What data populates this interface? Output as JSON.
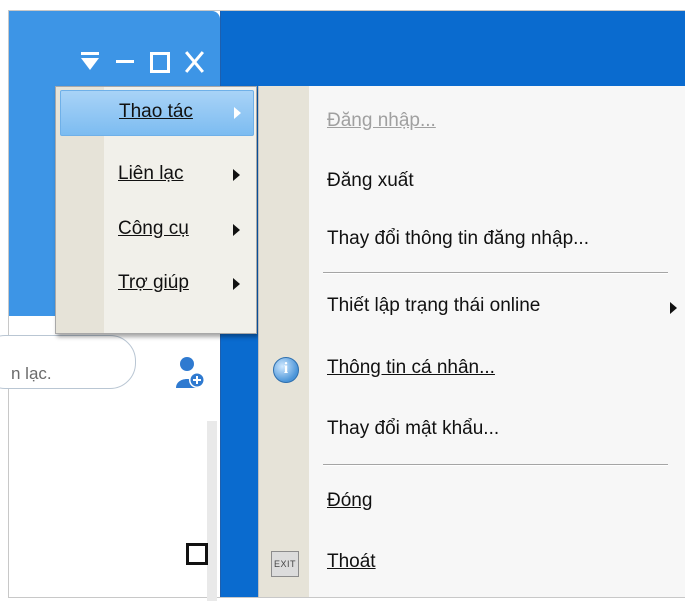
{
  "main_menu": {
    "items": [
      {
        "label": "Thao tác",
        "has_submenu": true,
        "selected": true
      },
      {
        "label": "Liên lạc",
        "has_submenu": true,
        "selected": false
      },
      {
        "label": "Công cụ",
        "has_submenu": true,
        "selected": false
      },
      {
        "label": "Trợ giúp",
        "has_submenu": true,
        "selected": false
      }
    ]
  },
  "submenu": {
    "items": [
      {
        "label": "Đăng nhập...",
        "disabled": true
      },
      {
        "label": "Đăng xuất",
        "disabled": false
      },
      {
        "label": "Thay đổi thông tin đăng nhập...",
        "disabled": false
      },
      {
        "label": "Thiết lập trạng thái online",
        "disabled": false,
        "has_submenu": true
      },
      {
        "label": "Thông tin cá nhân...",
        "disabled": false,
        "icon": "info-icon"
      },
      {
        "label": "Thay đổi mật khẩu...",
        "disabled": false
      },
      {
        "label": "Đóng",
        "disabled": false
      },
      {
        "label": "Thoát",
        "disabled": false,
        "icon": "exit-icon",
        "icon_text": "EXIT"
      }
    ]
  },
  "contact_search": {
    "visible_text": "n lạc."
  },
  "colors": {
    "titlebar": "#3d95e6",
    "desktop": "#0a6bcf",
    "selection": "#7cbcf1",
    "menu_gutter": "#e6e3d8"
  }
}
